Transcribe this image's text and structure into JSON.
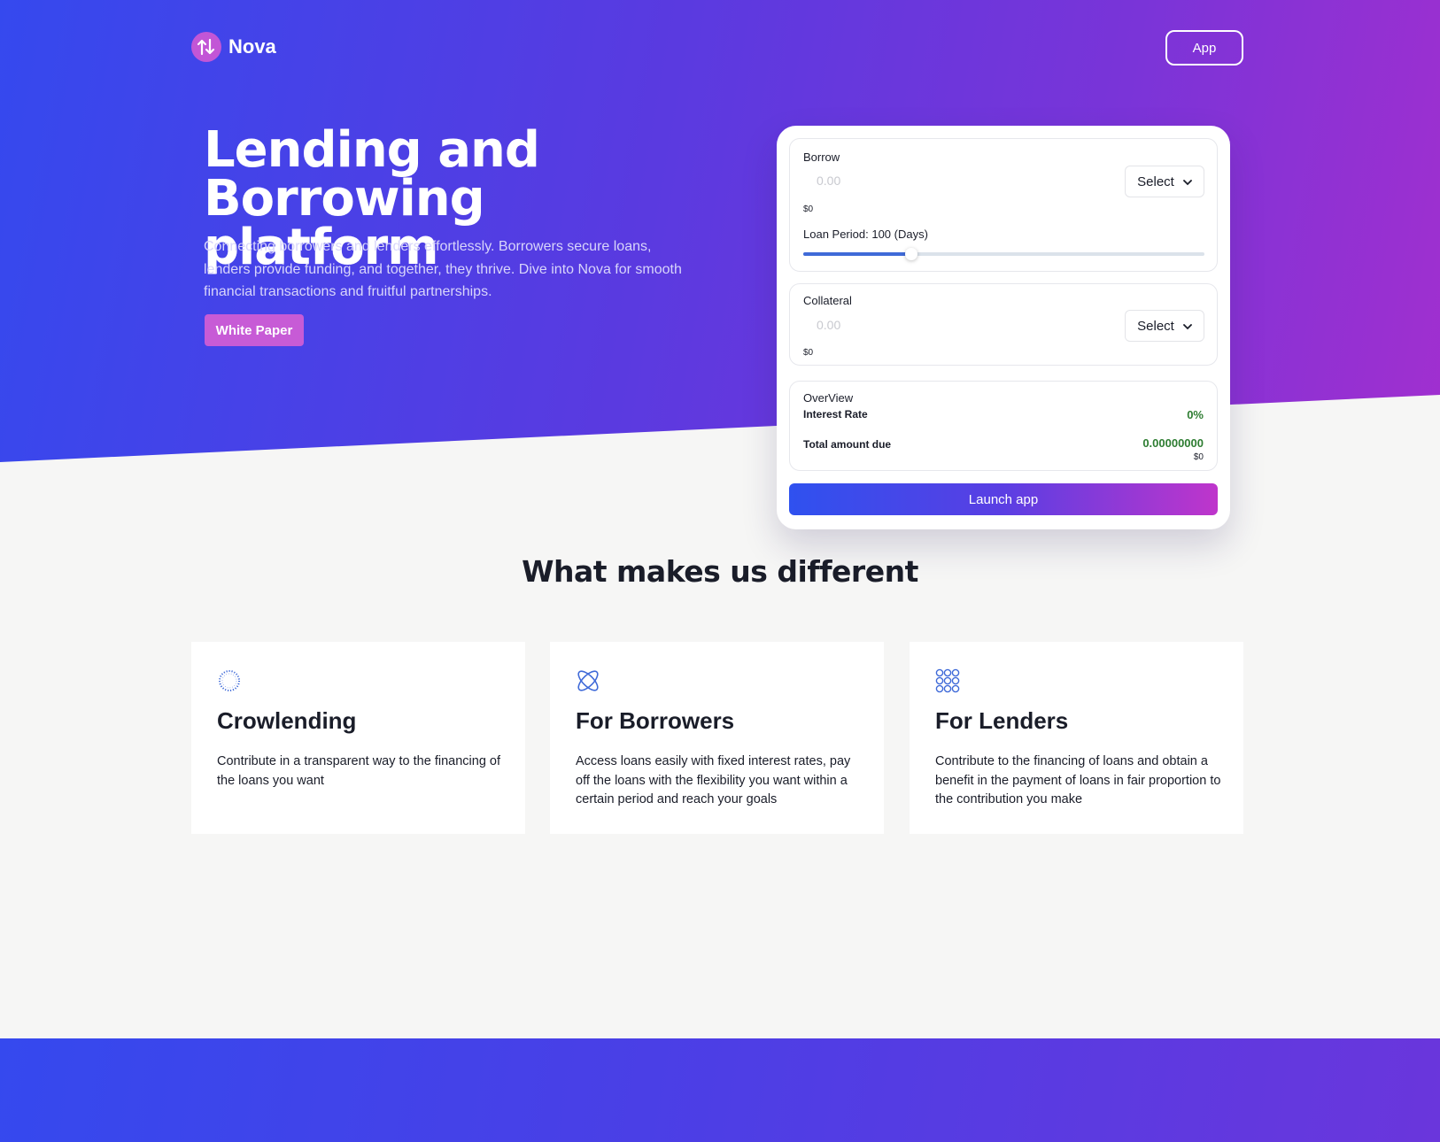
{
  "brand": {
    "name": "Nova",
    "logo_icon": "swap-arrows-icon"
  },
  "header": {
    "app_button": "App"
  },
  "hero": {
    "title_line1": "Lending and",
    "title_line2": "Borrowing platform",
    "description": "Connecting borrowers and lenders effortlessly. Borrowers secure loans, lenders provide funding, and together, they thrive. Dive into Nova for smooth financial transactions and fruitful partnerships.",
    "cta": "White Paper"
  },
  "card": {
    "borrow": {
      "label": "Borrow",
      "placeholder": "0.00",
      "select": "Select",
      "usd": "$0",
      "loan_period_label": "Loan Period: 100 (Days)",
      "loan_period_fraction": 0.27
    },
    "collateral": {
      "label": "Collateral",
      "placeholder": "0.00",
      "select": "Select",
      "usd": "$0"
    },
    "overview": {
      "label": "OverView",
      "interest_rate_label": "Interest Rate",
      "interest_rate_value": "0%",
      "total_label": "Total amount due",
      "total_value": "0.00000000",
      "total_usd": "$0"
    },
    "launch": "Launch app"
  },
  "features": {
    "title": "What makes us different",
    "items": [
      {
        "icon": "dotted-circle-icon",
        "title": "Crowlending",
        "text": "Contribute in a transparent way to the financing of the loans you want"
      },
      {
        "icon": "orbit-icon",
        "title": "For Borrowers",
        "text": "Access loans easily with fixed interest rates, pay off the loans with the flexibility you want within a certain period and reach your goals"
      },
      {
        "icon": "circle-grid-icon",
        "title": "For Lenders",
        "text": "Contribute to the financing of loans and obtain a benefit in the payment of loans in fair proportion to the contribution you make"
      }
    ]
  },
  "colors": {
    "gradient_start": "#3549ee",
    "gradient_end": "#a12fcf",
    "accent_pink": "#c75bd6",
    "positive_green": "#2e7d32"
  }
}
